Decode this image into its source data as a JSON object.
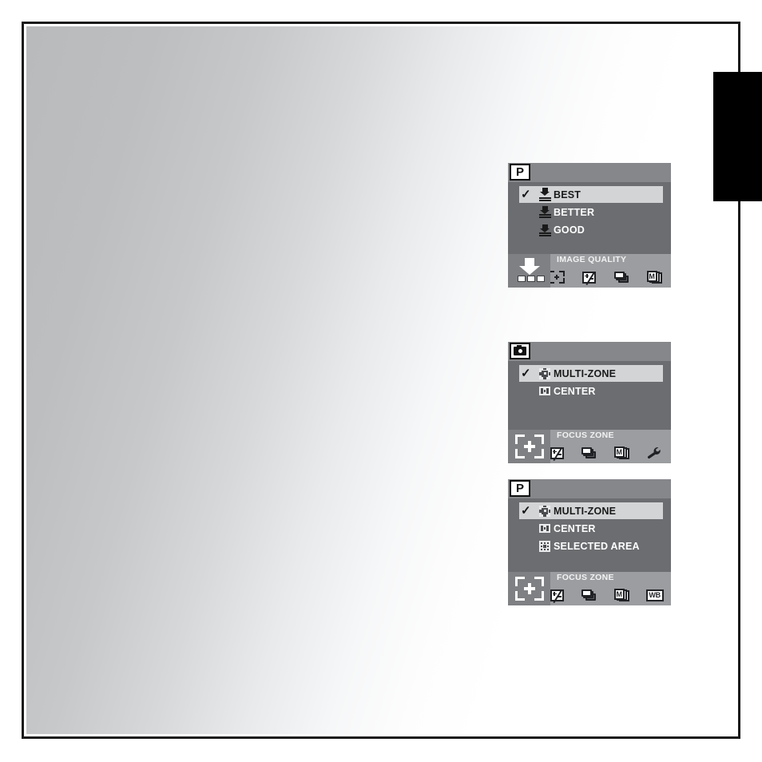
{
  "page": {
    "background_color": "#ffffff",
    "sheet_border_color": "#1a1a1a",
    "edge_tab_color": "#000000"
  },
  "panels": [
    {
      "id": "image-quality",
      "mode_badge": {
        "type": "letter",
        "label": "P"
      },
      "caption": "IMAGE QUALITY",
      "items": [
        {
          "label": "BEST",
          "icon": "quality-best-icon",
          "checked": true,
          "selected": true
        },
        {
          "label": "BETTER",
          "icon": "quality-better-icon",
          "checked": false,
          "selected": false
        },
        {
          "label": "GOOD",
          "icon": "quality-good-icon",
          "checked": false,
          "selected": false
        }
      ],
      "check_glyph": "✓",
      "active_tab_icon": "image-quality-icon",
      "tab_icons": [
        "image-quality-grid-icon",
        "focus-zone-icon",
        "exposure-compensation-icon",
        "burst-drive-icon",
        "metering-pages-icon"
      ]
    },
    {
      "id": "focus-zone-camera",
      "mode_badge": {
        "type": "camera",
        "label": ""
      },
      "caption": "FOCUS ZONE",
      "items": [
        {
          "label": "MULTI-ZONE",
          "icon": "multi-zone-icon",
          "checked": true,
          "selected": true
        },
        {
          "label": "CENTER",
          "icon": "center-zone-icon",
          "checked": false,
          "selected": false
        }
      ],
      "check_glyph": "✓",
      "active_tab_icon": "focus-zone-icon",
      "tab_icons": [
        "focus-zone-icon",
        "exposure-compensation-icon",
        "burst-drive-icon",
        "metering-pages-icon",
        "setup-wrench-icon"
      ]
    },
    {
      "id": "focus-zone-p",
      "mode_badge": {
        "type": "letter",
        "label": "P"
      },
      "caption": "FOCUS ZONE",
      "items": [
        {
          "label": "MULTI-ZONE",
          "icon": "multi-zone-icon",
          "checked": true,
          "selected": true
        },
        {
          "label": "CENTER",
          "icon": "center-zone-icon",
          "checked": false,
          "selected": false
        },
        {
          "label": "SELECTED AREA",
          "icon": "selected-area-icon",
          "checked": false,
          "selected": false
        }
      ],
      "check_glyph": "✓",
      "active_tab_icon": "focus-zone-icon",
      "tab_icons": [
        "focus-zone-icon",
        "exposure-compensation-icon",
        "burst-drive-icon",
        "metering-pages-icon",
        "white-balance-icon"
      ]
    }
  ],
  "icon_text": {
    "metering_letter": "M",
    "white_balance_letter": "WB"
  },
  "colors": {
    "lcd_background": "#6b6d70",
    "lcd_titlebar": "#85878a",
    "lcd_bottom_bar": "#9b9da0",
    "lcd_selected_row": "#d2d4d6",
    "lcd_active_swatch": "#7e8083",
    "lcd_text": "#ffffff",
    "lcd_selected_text": "#1a1a1a"
  }
}
